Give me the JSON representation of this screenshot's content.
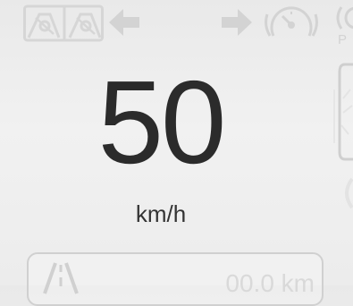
{
  "speedometer": {
    "value": "50",
    "unit": "km/h"
  },
  "trip": {
    "distance": "00.0 km"
  },
  "indicators": {
    "parking_letter": "P"
  },
  "colors": {
    "background": "#eeeeee",
    "speed_text": "#2b2b2b",
    "inactive_icon": "#d3d3d3"
  },
  "icons": [
    "seat-belt-warning-icon",
    "left-turn-arrow-icon",
    "right-turn-arrow-icon",
    "speed-limiter-icon",
    "parking-brake-icon",
    "door-open-icon",
    "road-lane-icon"
  ]
}
